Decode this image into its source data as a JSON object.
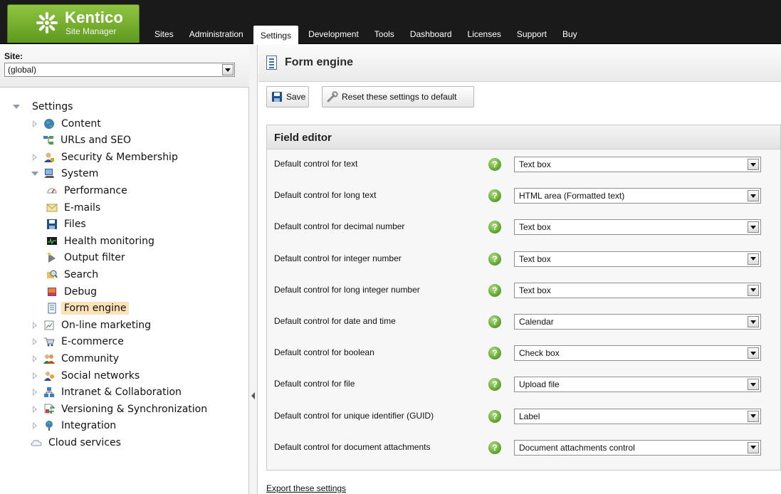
{
  "brand": {
    "name": "Kentico",
    "subtitle": "Site Manager"
  },
  "nav": {
    "items": [
      {
        "label": "Sites"
      },
      {
        "label": "Administration"
      },
      {
        "label": "Settings",
        "active": true
      },
      {
        "label": "Development"
      },
      {
        "label": "Tools"
      },
      {
        "label": "Dashboard"
      },
      {
        "label": "Licenses"
      },
      {
        "label": "Support"
      },
      {
        "label": "Buy"
      }
    ]
  },
  "site": {
    "label": "Site:",
    "selected": "(global)"
  },
  "tree": {
    "items": [
      {
        "label": "Settings",
        "icon": "none",
        "toggle": "open"
      },
      {
        "label": "Content",
        "icon": "globe-icon",
        "toggle": "closed"
      },
      {
        "label": "URLs and SEO",
        "icon": "sitemap-icon",
        "toggle": "none"
      },
      {
        "label": "Security & Membership",
        "icon": "user-lock-icon",
        "toggle": "closed"
      },
      {
        "label": "System",
        "icon": "computer-icon",
        "toggle": "open"
      },
      {
        "label": "Performance",
        "icon": "gauge-icon",
        "toggle": "none"
      },
      {
        "label": "E-mails",
        "icon": "envelope-icon",
        "toggle": "none"
      },
      {
        "label": "Files",
        "icon": "floppy-icon",
        "toggle": "none"
      },
      {
        "label": "Health monitoring",
        "icon": "monitor-icon",
        "toggle": "none"
      },
      {
        "label": "Output filter",
        "icon": "filter-icon",
        "toggle": "none"
      },
      {
        "label": "Search",
        "icon": "search-icon",
        "toggle": "none"
      },
      {
        "label": "Debug",
        "icon": "debug-icon",
        "toggle": "none"
      },
      {
        "label": "Form engine",
        "icon": "form-icon",
        "toggle": "none",
        "selected": true
      },
      {
        "label": "On-line marketing",
        "icon": "chart-icon",
        "toggle": "closed"
      },
      {
        "label": "E-commerce",
        "icon": "cart-icon",
        "toggle": "closed"
      },
      {
        "label": "Community",
        "icon": "group-icon",
        "toggle": "closed"
      },
      {
        "label": "Social networks",
        "icon": "social-icon",
        "toggle": "closed"
      },
      {
        "label": "Intranet & Collaboration",
        "icon": "network-icon",
        "toggle": "closed"
      },
      {
        "label": "Versioning & Synchronization",
        "icon": "sync-icon",
        "toggle": "closed"
      },
      {
        "label": "Integration",
        "icon": "integration-icon",
        "toggle": "closed"
      },
      {
        "label": "Cloud services",
        "icon": "cloud-icon",
        "toggle": "none"
      }
    ]
  },
  "page": {
    "title": "Form engine"
  },
  "toolbar": {
    "save_label": "Save",
    "reset_label": "Reset these settings to default"
  },
  "section": {
    "title": "Field editor",
    "fields": [
      {
        "label": "Default control for text",
        "value": "Text box"
      },
      {
        "label": "Default control for long text",
        "value": "HTML area (Formatted text)"
      },
      {
        "label": "Default control for decimal number",
        "value": "Text box"
      },
      {
        "label": "Default control for integer number",
        "value": "Text box"
      },
      {
        "label": "Default control for long integer number",
        "value": "Text box"
      },
      {
        "label": "Default control for date and time",
        "value": "Calendar"
      },
      {
        "label": "Default control for boolean",
        "value": "Check box"
      },
      {
        "label": "Default control for file",
        "value": "Upload file"
      },
      {
        "label": "Default control for unique identifier (GUID)",
        "value": "Label"
      },
      {
        "label": "Default control for document attachments",
        "value": "Document attachments control"
      }
    ]
  },
  "footer": {
    "export_label": "Export these settings"
  },
  "colors": {
    "brand_green": "#6fae2a",
    "topbar": "#1a1a1a",
    "selected_highlight": "#fde2b8",
    "help_green": "#5a9e28"
  }
}
